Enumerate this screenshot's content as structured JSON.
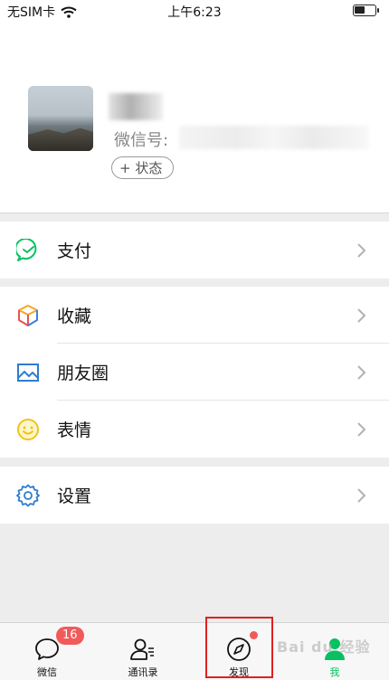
{
  "status_bar": {
    "carrier": "无SIM卡",
    "time": "上午6:23",
    "battery_level": 0.5
  },
  "profile": {
    "wechat_id_label": "微信号:",
    "status_button": "+ 状态"
  },
  "menu": {
    "pay": "支付",
    "favorites": "收藏",
    "moments": "朋友圈",
    "stickers": "表情",
    "settings": "设置"
  },
  "tabbar": {
    "chats": {
      "label": "微信",
      "badge": "16"
    },
    "contacts": {
      "label": "通讯录"
    },
    "discover": {
      "label": "发现",
      "has_dot": true
    },
    "me": {
      "label": "我",
      "active": true
    }
  },
  "watermark": "Bai du 经验",
  "colors": {
    "accent": "#07c160",
    "badge": "#f25a5a",
    "highlight": "#e02020"
  }
}
